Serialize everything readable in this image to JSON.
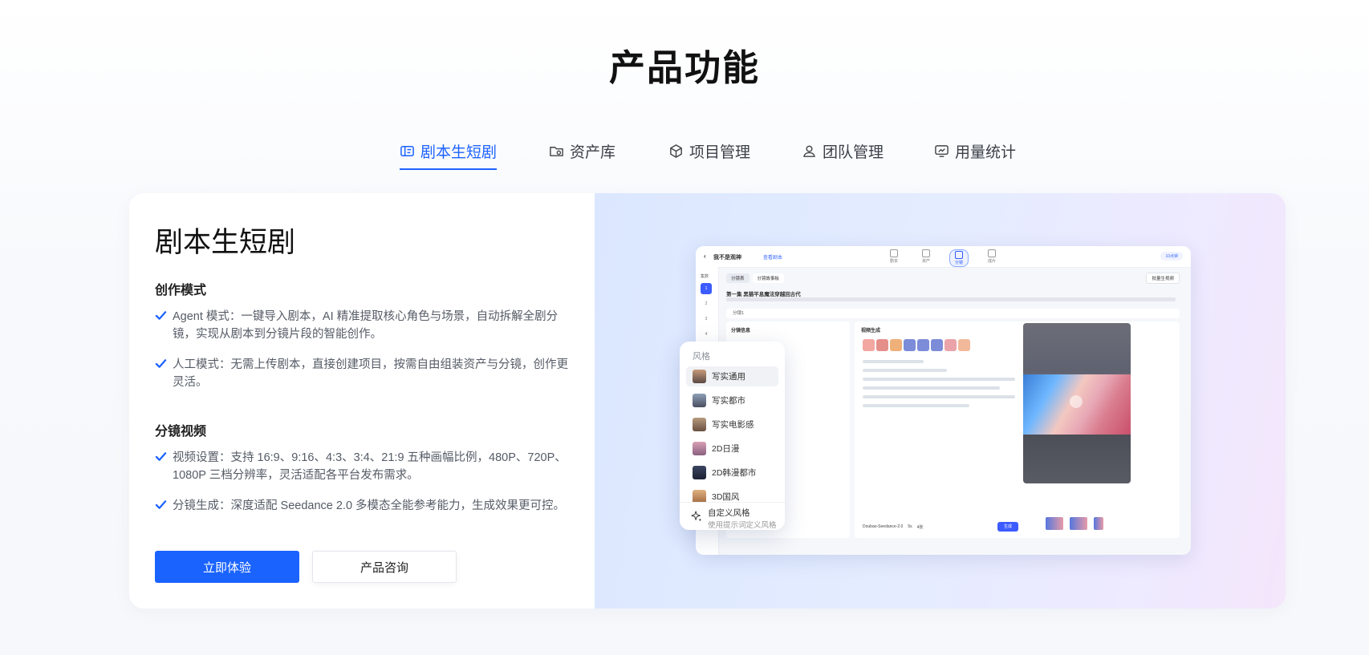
{
  "page": {
    "title": "产品功能"
  },
  "tabs": [
    {
      "label": "剧本生短剧",
      "icon": "script-icon",
      "active": true
    },
    {
      "label": "资产库",
      "icon": "folder-icon",
      "active": false
    },
    {
      "label": "项目管理",
      "icon": "cube-icon",
      "active": false
    },
    {
      "label": "团队管理",
      "icon": "user-icon",
      "active": false
    },
    {
      "label": "用量统计",
      "icon": "monitor-chart-icon",
      "active": false
    }
  ],
  "feature": {
    "heading": "剧本生短剧",
    "sections": [
      {
        "title": "创作模式",
        "items": [
          "Agent 模式：一键导入剧本，AI 精准提取核心角色与场景，自动拆解全剧分镜，实现从剧本到分镜片段的智能创作。",
          "人工模式：无需上传剧本，直接创建项目，按需自由组装资产与分镜，创作更灵活。"
        ]
      },
      {
        "title": "分镜视频",
        "items": [
          "视频设置：支持 16:9、9:16、4:3、3:4、21:9 五种画幅比例，480P、720P、1080P 三档分辨率，灵活适配各平台发布需求。",
          "分镜生成：深度适配 Seedance 2.0 多模态全能参考能力，生成效果更可控。"
        ]
      }
    ],
    "buttons": {
      "primary": "立即体验",
      "secondary": "产品咨询"
    }
  },
  "mock": {
    "project_name": "我不是观神",
    "tag": "查看剧本",
    "steps": [
      "剧本",
      "资产",
      "分镜",
      "成片"
    ],
    "top_right": "10点钟",
    "side_label": "集数",
    "episodes": [
      "1",
      "2",
      "3",
      "4",
      "5"
    ],
    "sub_tabs": [
      "分镜表",
      "分镜故事板"
    ],
    "batch_button": "批量生视频",
    "episode_title": "第一集 黑猫平息魔法穿越回古代",
    "shot_label": "分镜1",
    "panel_left": "分镜信息",
    "panel_right": "视频生成",
    "model": "Doubao-Seedance-2.0",
    "duration": "5s",
    "count": "4张",
    "generate": "生成",
    "style_popup": {
      "header": "风格",
      "options": [
        "写实通用",
        "写实都市",
        "写实电影感",
        "2D日漫",
        "2D韩漫都市",
        "3D国风"
      ],
      "selected": "写实通用",
      "custom_title": "自定义风格",
      "custom_hint": "使用提示词定义风格"
    }
  },
  "colors": {
    "accent": "#1d63ff",
    "primary_button": "#1a63ff"
  }
}
